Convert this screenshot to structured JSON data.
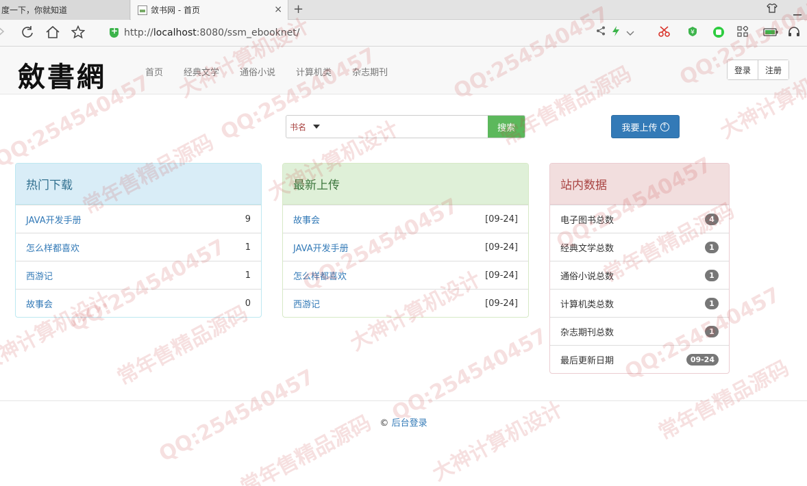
{
  "browser": {
    "tabs": [
      {
        "label": "度一下，你就知道",
        "active": false
      },
      {
        "label": "敛书网 - 首页",
        "active": true
      }
    ],
    "close_glyph": "×",
    "new_tab_glyph": "+",
    "url_prefix": "http://",
    "url_host": "localhost",
    "url_rest": ":8080/ssm_ebooknet/"
  },
  "header": {
    "logo": "斂書網",
    "nav": [
      "首页",
      "经典文学",
      "通俗小说",
      "计算机类",
      "杂志期刊"
    ],
    "login_label": "登录",
    "register_label": "注册"
  },
  "search": {
    "type_label": "书名",
    "button_label": "搜索",
    "upload_label": "我要上传"
  },
  "panels": {
    "hot": {
      "title": "热门下载",
      "rows": [
        {
          "name": "JAVA开发手册",
          "value": "9"
        },
        {
          "name": "怎么样都喜欢",
          "value": "1"
        },
        {
          "name": "西游记",
          "value": "1"
        },
        {
          "name": "故事会",
          "value": "0"
        }
      ]
    },
    "latest": {
      "title": "最新上传",
      "rows": [
        {
          "name": "故事会",
          "value": "[09-24]"
        },
        {
          "name": "JAVA开发手册",
          "value": "[09-24]"
        },
        {
          "name": "怎么样都喜欢",
          "value": "[09-24]"
        },
        {
          "name": "西游记",
          "value": "[09-24]"
        }
      ]
    },
    "stats": {
      "title": "站内数据",
      "rows": [
        {
          "name": "电子图书总数",
          "value": "4"
        },
        {
          "name": "经典文学总数",
          "value": "1"
        },
        {
          "name": "通俗小说总数",
          "value": "1"
        },
        {
          "name": "计算机类总数",
          "value": "1"
        },
        {
          "name": "杂志期刊总数",
          "value": "1"
        },
        {
          "name": "最后更新日期",
          "value": "09-24"
        }
      ]
    }
  },
  "footer": {
    "copyright": "©",
    "admin_link": "后台登录"
  },
  "watermark": {
    "texts": [
      "QQ:254540457",
      "大神计算机设计",
      "常年售精品源码"
    ]
  },
  "colors": {
    "primary": "#337ab7",
    "success": "#5cb85c",
    "info_bg": "#d9edf7",
    "success_bg": "#dff0d8",
    "danger_bg": "#f2dede",
    "badge": "#777777"
  }
}
